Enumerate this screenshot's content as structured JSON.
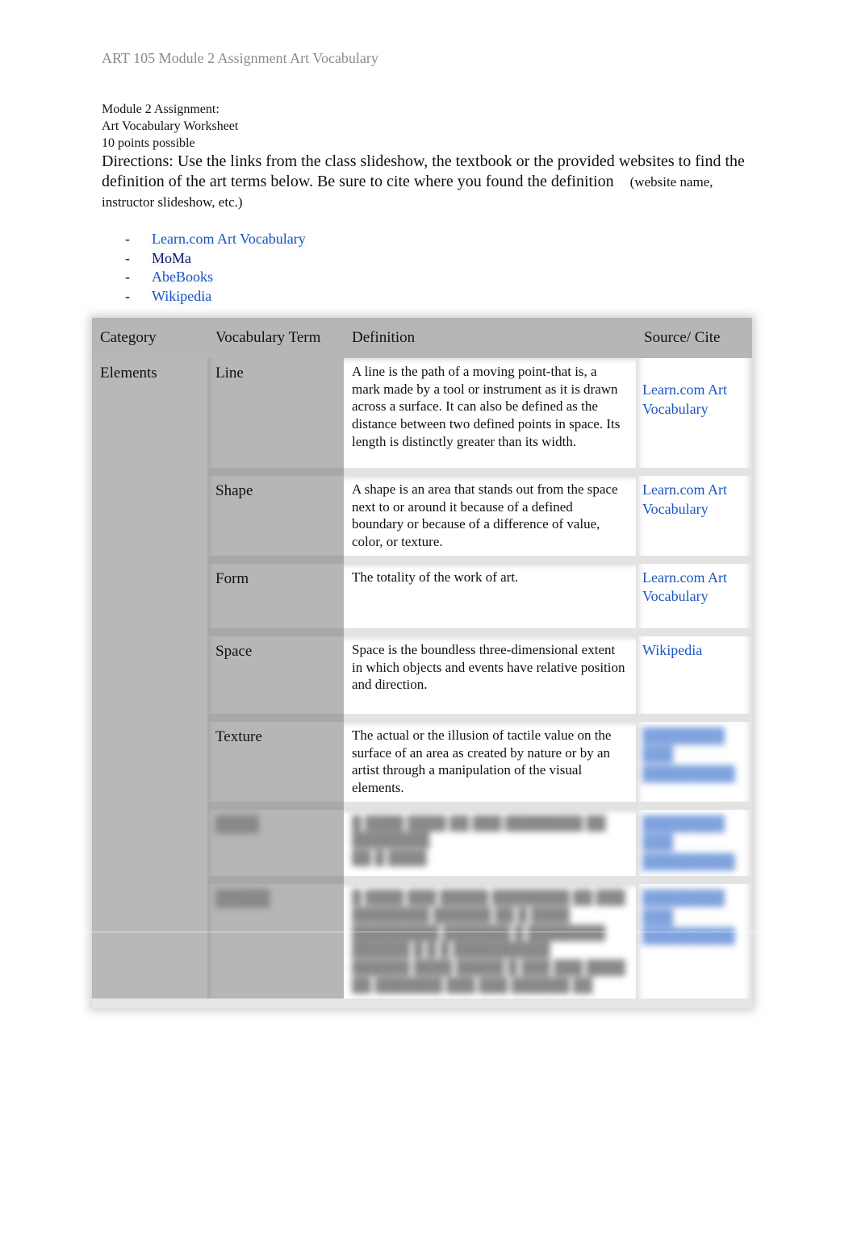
{
  "header": {
    "title": "ART 105 Module 2 Assignment Art Vocabulary"
  },
  "intro": {
    "line1": "Module 2 Assignment:",
    "line2": "Art Vocabulary Worksheet",
    "line3": "10 points possible"
  },
  "directions": {
    "main": "Directions: Use the links from the class slideshow, the textbook or the provided websites to find the definition of the art terms below. Be sure to cite where you found the definition",
    "note": "(website name, instructor slideshow, etc.)"
  },
  "links": [
    {
      "dash": "-",
      "label": "Learn.com Art Vocabulary"
    },
    {
      "dash": "-",
      "label": "MoMa"
    },
    {
      "dash": "-",
      "label": "AbeBooks"
    },
    {
      "dash": "-",
      "label": "Wikipedia"
    }
  ],
  "table": {
    "headers": [
      "Category",
      "Vocabulary Term",
      "Definition",
      "Source/ Cite"
    ],
    "category": "Elements",
    "rows": [
      {
        "term": "Line",
        "definition": "A line is the path of a moving point-that is, a mark made by a tool or instrument as it is drawn across a surface. It can also be defined as the distance between two defined points in space. Its length is distinctly greater than its width.",
        "source": "Learn.com Art Vocabulary"
      },
      {
        "term": "Shape",
        "definition": "A shape is an area that stands out from the space next to or around it because of a defined boundary or because of a difference of value, color, or texture.",
        "source": "Learn.com Art Vocabulary"
      },
      {
        "term": "Form",
        "definition": "The totality of the work of art.",
        "source": "Learn.com Art Vocabulary"
      },
      {
        "term": "Space",
        "definition": "Space is the boundless three-dimensional extent in which objects and events have relative position and direction.",
        "source": "Wikipedia"
      },
      {
        "term": "Texture",
        "definition": "The actual or the illusion of tactile value on the surface of an area as created by nature or by an artist through a manipulation of the visual elements.",
        "source": ""
      }
    ],
    "blurred_rows": 2
  }
}
